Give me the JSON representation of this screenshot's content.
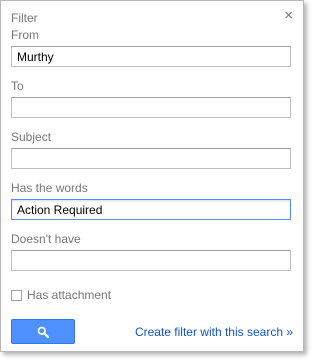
{
  "dialog": {
    "title": "Filter",
    "close_glyph": "×"
  },
  "fields": {
    "from": {
      "label": "From",
      "value": "Murthy"
    },
    "to": {
      "label": "To",
      "value": ""
    },
    "subject": {
      "label": "Subject",
      "value": ""
    },
    "has_words": {
      "label": "Has the words",
      "value": "Action Required"
    },
    "doesnt_have": {
      "label": "Doesn't have",
      "value": ""
    }
  },
  "attachment": {
    "label": "Has attachment",
    "checked": false
  },
  "actions": {
    "search_icon": "search-icon",
    "create_filter_link": "Create filter with this search »"
  },
  "colors": {
    "accent": "#4d90fe",
    "link": "#1155cc",
    "label_text": "#777777"
  }
}
